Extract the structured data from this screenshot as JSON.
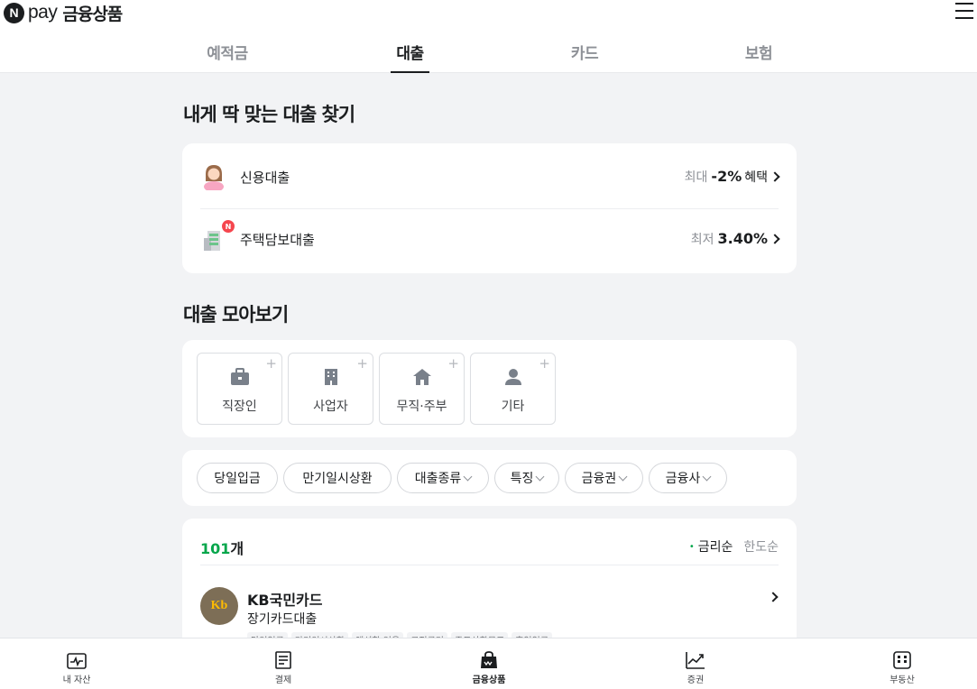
{
  "header": {
    "logo_mark": "N",
    "logo_pay": "pay",
    "logo_title": "금융상품",
    "menu_icon": "hamburger-menu-icon"
  },
  "tabs": [
    {
      "label": "예적금",
      "active": false
    },
    {
      "label": "대출",
      "active": true
    },
    {
      "label": "카드",
      "active": false
    },
    {
      "label": "보험",
      "active": false
    }
  ],
  "find_section": {
    "title": "내게 딱 맞는 대출 찾기",
    "items": [
      {
        "name": "신용대출",
        "icon": "person-emoji-icon",
        "meta_prefix": "최대",
        "meta_value": "-2%",
        "meta_suffix": "혜택"
      },
      {
        "name": "주택담보대출",
        "icon": "building-emoji-icon",
        "badge": "N",
        "meta_prefix": "최저",
        "meta_value": "3.40%",
        "meta_suffix": ""
      }
    ]
  },
  "browse_section": {
    "title": "대출 모아보기",
    "categories": [
      {
        "label": "직장인",
        "icon": "briefcase-icon"
      },
      {
        "label": "사업자",
        "icon": "office-building-icon"
      },
      {
        "label": "무직·주부",
        "icon": "home-icon"
      },
      {
        "label": "기타",
        "icon": "person-icon"
      }
    ],
    "plus": "+"
  },
  "filters": [
    {
      "label": "당일입금",
      "dropdown": false
    },
    {
      "label": "만기일시상환",
      "dropdown": false
    },
    {
      "label": "대출종류",
      "dropdown": true
    },
    {
      "label": "특징",
      "dropdown": true
    },
    {
      "label": "금융권",
      "dropdown": true
    },
    {
      "label": "금융사",
      "dropdown": true
    }
  ],
  "results": {
    "count": "101",
    "count_unit": "개",
    "sort_options": [
      {
        "label": "금리순",
        "active": true
      },
      {
        "label": "한도순",
        "active": false
      }
    ],
    "items": [
      {
        "logo_text": "Kb",
        "bank": "KB국민카드",
        "product": "장기카드대출",
        "tags": [
          "당일입금",
          "만기일시상환",
          "액션할 없음",
          "구정금리",
          "중도상환무료",
          "후입입금"
        ]
      }
    ]
  },
  "bottom_nav": [
    {
      "label": "내 자산",
      "icon": "wallet-chart-icon",
      "active": false
    },
    {
      "label": "결제",
      "icon": "receipt-icon",
      "active": false
    },
    {
      "label": "금융상품",
      "icon": "shopping-bag-icon",
      "active": true
    },
    {
      "label": "증권",
      "icon": "stock-chart-icon",
      "active": false
    },
    {
      "label": "부동산",
      "icon": "building-icon",
      "active": false
    }
  ],
  "colors": {
    "accent_green": "#05a64b",
    "background": "#f2f3f5",
    "badge_red": "#f5464e",
    "text": "#1b1d1f",
    "muted": "#8e9197"
  }
}
